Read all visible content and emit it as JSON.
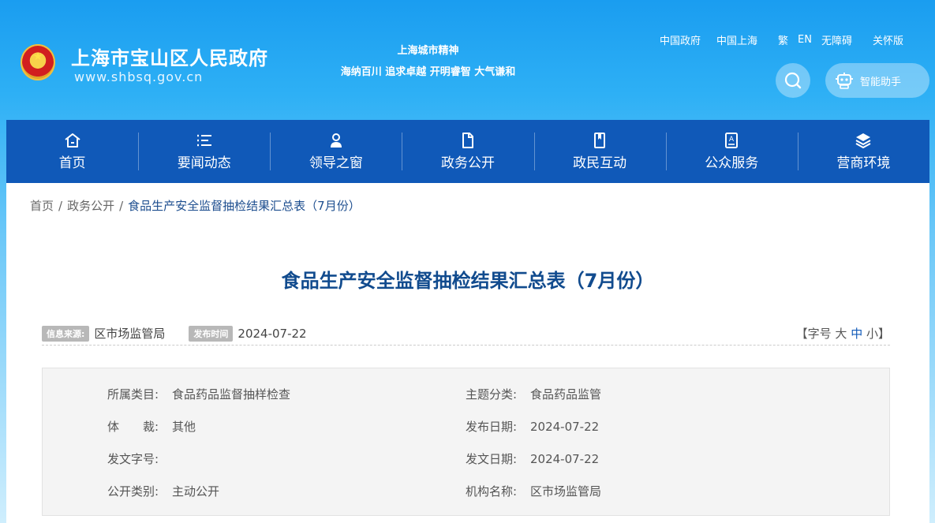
{
  "header": {
    "site_name": "上海市宝山区人民政府",
    "site_url": "www.shbsq.gov.cn",
    "spirit_title": "上海城市精神",
    "spirit_text": "海纳百川 追求卓越 开明睿智 大气谦和",
    "top_links": [
      "中国政府",
      "中国上海",
      "繁",
      "EN",
      "无障碍",
      "关怀版"
    ],
    "assistant_label": "智能助手"
  },
  "nav": {
    "items": [
      {
        "label": "首页",
        "icon": "home-icon"
      },
      {
        "label": "要闻动态",
        "icon": "list-icon"
      },
      {
        "label": "领导之窗",
        "icon": "person-icon"
      },
      {
        "label": "政务公开",
        "icon": "document-icon"
      },
      {
        "label": "政民互动",
        "icon": "bookmark-icon"
      },
      {
        "label": "公众服务",
        "icon": "form-icon"
      },
      {
        "label": "营商环境",
        "icon": "layers-icon"
      }
    ]
  },
  "breadcrumb": {
    "home": "首页",
    "section": "政务公开",
    "current": "食品生产安全监督抽检结果汇总表（7月份）"
  },
  "article": {
    "title": "食品生产安全监督抽检结果汇总表（7月份）",
    "source_badge": "信息来源:",
    "source_value": "区市场监管局",
    "date_badge": "发布时间",
    "date_value": "2024-07-22",
    "font_size_open": "【字号",
    "font_large": "大",
    "font_medium": "中",
    "font_small": "小】"
  },
  "info": {
    "category_key": "所属类目:",
    "category_val": "食品药品监督抽样检查",
    "topic_key": "主题分类:",
    "topic_val": "食品药品监管",
    "genre_key": "体　　裁:",
    "genre_val": "其他",
    "pubdate_key": "发布日期:",
    "pubdate_val": "2024-07-22",
    "docno_key": "发文字号:",
    "docno_val": "",
    "issue_key": "发文日期:",
    "issue_val": "2024-07-22",
    "open_key": "公开类别:",
    "open_val": "主动公开",
    "org_key": "机构名称:",
    "org_val": "区市场监管局"
  },
  "colors": {
    "nav_bg": "#1059b8",
    "title_blue": "#114b8e",
    "header_gradient_top": "#1a9df0"
  }
}
